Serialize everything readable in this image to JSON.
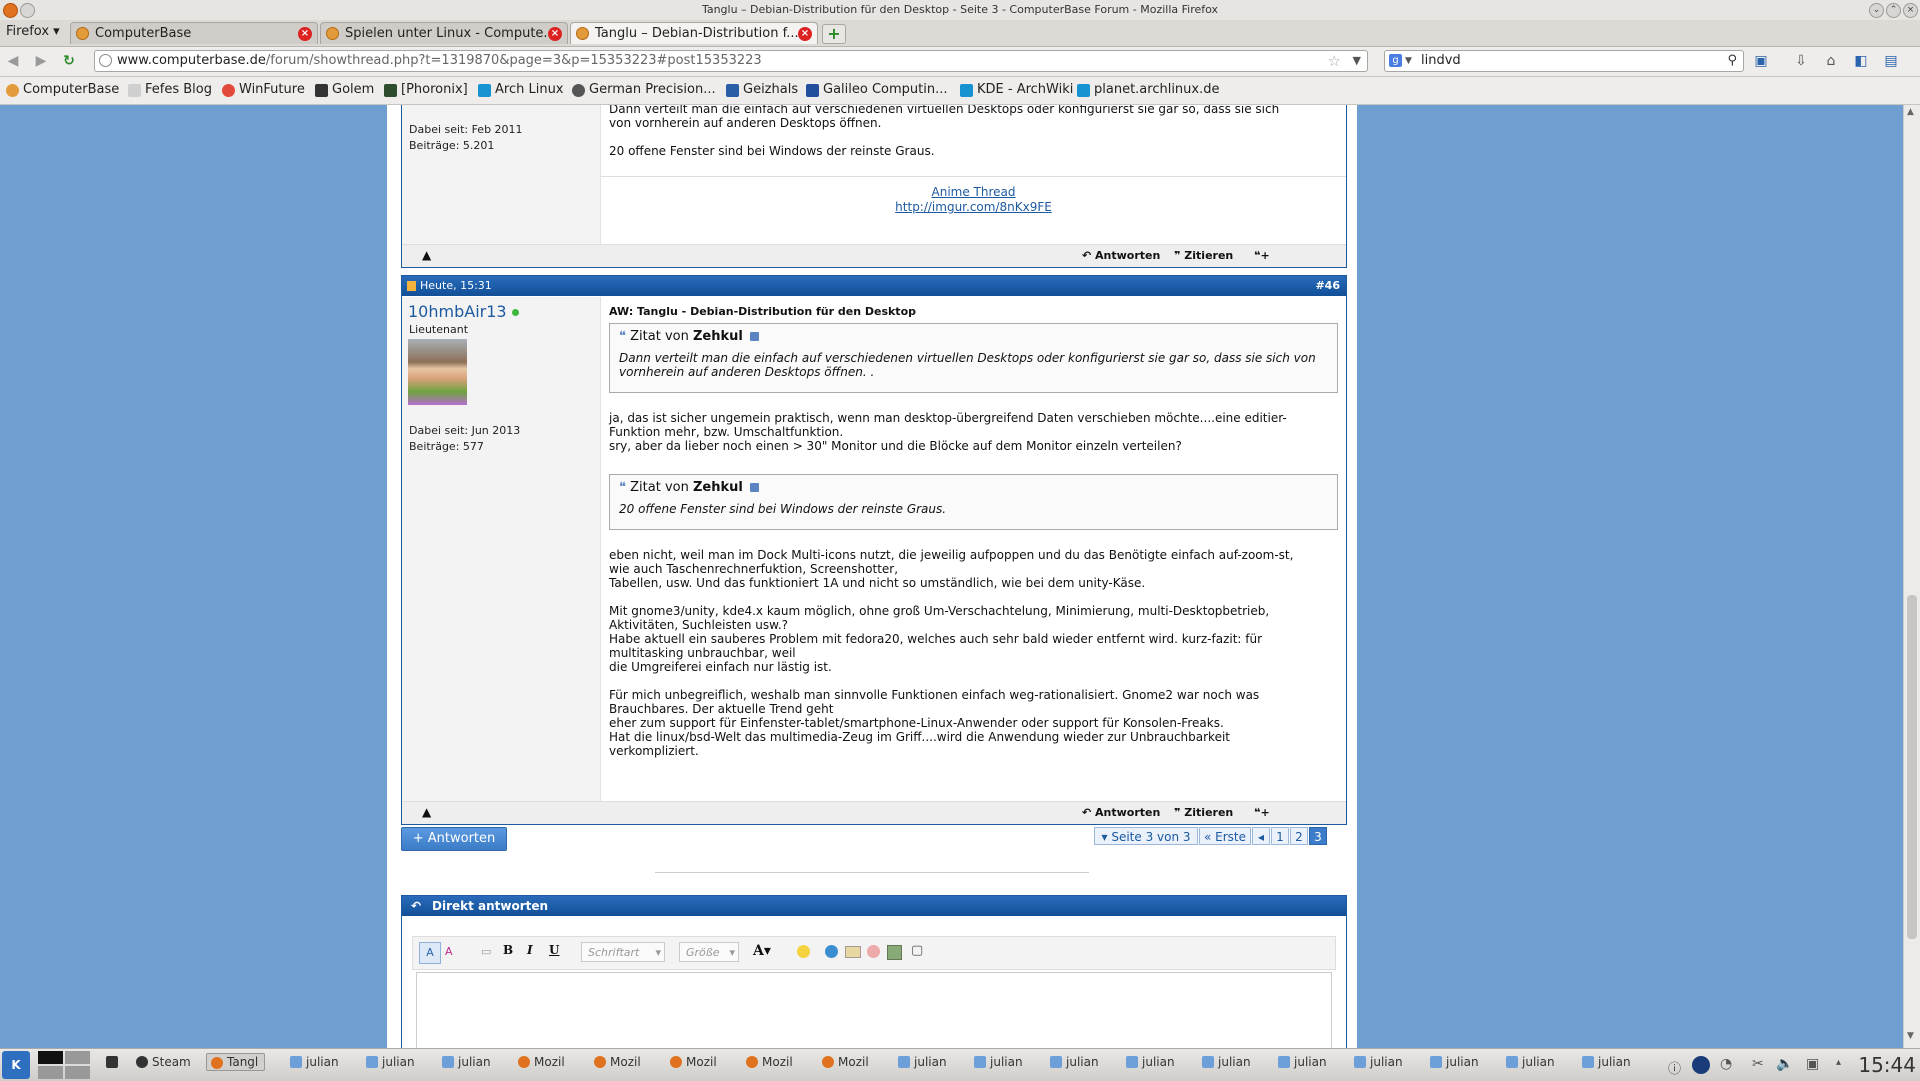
{
  "window": {
    "title": "Tanglu – Debian-Distribution für den Desktop - Seite 3 - ComputerBase Forum - Mozilla Firefox"
  },
  "firefox_menu": "Firefox",
  "tabs": [
    {
      "label": "ComputerBase"
    },
    {
      "label": "Spielen unter Linux - Compute..."
    },
    {
      "label": "Tanglu – Debian-Distribution f..."
    }
  ],
  "url": {
    "host": "www.computerbase.de",
    "path": "/forum/showthread.php?t=1319870&page=3&p=15353223#post15353223"
  },
  "search": {
    "value": "lindvd"
  },
  "bookmarks": [
    "ComputerBase",
    "Fefes Blog",
    "WinFuture",
    "Golem",
    "[Phoronix]",
    "Arch Linux",
    "German Precision...",
    "Geizhals",
    "Galileo Computin...",
    "KDE - ArchWiki",
    "planet.archlinux.de"
  ],
  "post_prev": {
    "joined": "Dabei seit: Feb 2011",
    "posts": "Beiträge: 5.201",
    "body_line1": "Dann verteilt man die einfach auf verschiedenen virtuellen Desktops oder konfigurierst sie gar so, dass sie sich",
    "body_line2": "von vornherein auf anderen Desktops öffnen.",
    "body_line3": "20 offene Fenster sind bei Windows der reinste Graus.",
    "sig_link1": "Anime Thread",
    "sig_link2": "http://imgur.com/8nKx9FE"
  },
  "actions": {
    "reply": "Antworten",
    "quote": "Zitieren"
  },
  "post": {
    "date": "Heute, 15:31",
    "number": "#46",
    "username": "10hmbAir13",
    "rank": "Lieutenant",
    "joined": "Dabei seit: Jun 2013",
    "posts": "Beiträge: 577",
    "title": "AW: Tanglu - Debian-Distribution für den Desktop",
    "quote_prefix": "Zitat von",
    "quote1_author": "Zehkul",
    "quote1_text": "Dann verteilt man die einfach auf verschiedenen virtuellen Desktops oder konfigurierst sie gar so, dass sie sich von vornherein auf anderen Desktops öffnen. .",
    "para1_l1": "ja, das ist sicher ungemein praktisch, wenn man desktop-übergreifend Daten verschieben möchte....eine editier-",
    "para1_l2": "Funktion mehr, bzw. Umschaltfunktion.",
    "para1_l3": "sry, aber da lieber noch einen > 30\" Monitor und die Blöcke auf dem Monitor einzeln verteilen?",
    "quote2_author": "Zehkul",
    "quote2_text": "20 offene Fenster sind bei Windows der reinste Graus.",
    "para2_l1": "eben nicht, weil man im Dock Multi-icons nutzt, die jeweilig aufpoppen und du das Benötigte einfach auf-zoom-st,",
    "para2_l2": "wie auch Taschenrechnerfuktion, Screenshotter,",
    "para2_l3": "Tabellen, usw. Und das funktioniert 1A und nicht so umständlich, wie bei dem unity-Käse.",
    "para3_l1": "Mit gnome3/unity, kde4.x kaum möglich, ohne groß Um-Verschachtelung, Minimierung, multi-Desktopbetrieb,",
    "para3_l2": "Aktivitäten, Suchleisten usw.?",
    "para3_l3": "Habe aktuell ein sauberes Problem mit fedora20, welches auch sehr bald wieder entfernt wird. kurz-fazit: für",
    "para3_l4": "multitasking unbrauchbar, weil",
    "para3_l5": "die Umgreiferei einfach nur lästig ist.",
    "para4_l1": "Für mich unbegreiflich, weshalb man sinnvolle Funktionen einfach weg-rationalisiert. Gnome2 war noch was",
    "para4_l2": "Brauchbares. Der aktuelle Trend geht",
    "para4_l3": "eher zum support für Einfenster-tablet/smartphone-Linux-Anwender oder support für Konsolen-Freaks.",
    "para4_l4": "Hat die linux/bsd-Welt das multimedia-Zeug im Griff....wird die Anwendung wieder zur Unbrauchbarkeit",
    "para4_l5": "verkompliziert."
  },
  "reply_button": "+ Antworten",
  "pagination": {
    "label": "Seite 3 von 3",
    "first": "Erste",
    "pages": [
      "1",
      "2",
      "3"
    ]
  },
  "quick_reply": {
    "title": "Direkt antworten",
    "font_placeholder": "Schriftart",
    "size_placeholder": "Größe",
    "bold": "B",
    "italic": "I",
    "underline": "U",
    "color": "A"
  },
  "taskbar": {
    "items": [
      "Steam",
      "Tangl",
      "julian",
      "julian",
      "julian",
      "Mozil",
      "Mozil",
      "Mozil",
      "Mozil",
      "Mozil",
      "julian",
      "julian",
      "julian",
      "julian",
      "julian",
      "julian",
      "julian",
      "julian",
      "julian",
      "julian"
    ],
    "clock": "15:44"
  },
  "colors": {
    "accent": "#1e5aa0",
    "online": "#3db83d",
    "background": "#6f9fd0"
  }
}
